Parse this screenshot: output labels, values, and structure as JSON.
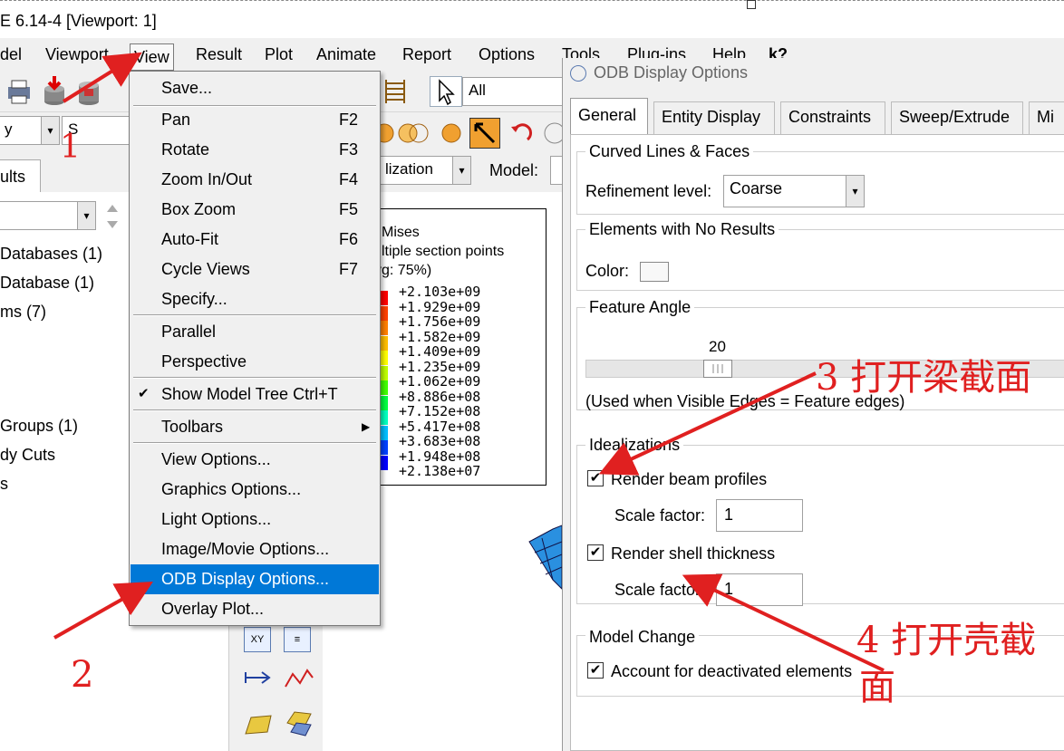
{
  "window": {
    "title": "E 6.14-4 [Viewport: 1]"
  },
  "menubar": {
    "items": [
      "del",
      "Viewport",
      "View",
      "Result",
      "Plot",
      "Animate",
      "Report",
      "Options",
      "Tools",
      "Plug-ins",
      "Help",
      "k?"
    ]
  },
  "toolbar": {
    "selection_combo": "All",
    "left_combo_1": "y",
    "left_combo_2": "S",
    "visualization_combo": "lization",
    "model_label": "Model:"
  },
  "left_panel": {
    "tab_label": "ults",
    "tree_items": [
      "Databases (1)",
      "Database (1)",
      "ms (7)",
      "Groups (1)",
      "dy Cuts",
      "s"
    ]
  },
  "legend": {
    "title_lines": [
      "Mises",
      "ltiple section points",
      "vg: 75%)"
    ],
    "values": [
      "+2.103e+09",
      "+1.929e+09",
      "+1.756e+09",
      "+1.582e+09",
      "+1.409e+09",
      "+1.235e+09",
      "+1.062e+09",
      "+8.886e+08",
      "+7.152e+08",
      "+5.417e+08",
      "+3.683e+08",
      "+1.948e+08",
      "+2.138e+07"
    ],
    "colors": [
      "#ff0000",
      "#ff4000",
      "#ff8000",
      "#ffbf00",
      "#ffff00",
      "#bfff00",
      "#40ff00",
      "#00ff40",
      "#00ffbf",
      "#00bfff",
      "#0040ff",
      "#0000ff"
    ]
  },
  "view_menu": {
    "items": [
      {
        "label": "Save...",
        "shortcut": ""
      },
      {
        "label": "Pan",
        "shortcut": "F2"
      },
      {
        "label": "Rotate",
        "shortcut": "F3"
      },
      {
        "label": "Zoom In/Out",
        "shortcut": "F4"
      },
      {
        "label": "Box Zoom",
        "shortcut": "F5"
      },
      {
        "label": "Auto-Fit",
        "shortcut": "F6"
      },
      {
        "label": "Cycle Views",
        "shortcut": "F7"
      },
      {
        "label": "Specify...",
        "shortcut": ""
      },
      {
        "label": "Parallel",
        "shortcut": ""
      },
      {
        "label": "Perspective",
        "shortcut": ""
      },
      {
        "label": "Show Model Tree Ctrl+T",
        "shortcut": ""
      },
      {
        "label": "Toolbars",
        "shortcut": ""
      },
      {
        "label": "View Options...",
        "shortcut": ""
      },
      {
        "label": "Graphics Options...",
        "shortcut": ""
      },
      {
        "label": "Light Options...",
        "shortcut": ""
      },
      {
        "label": "Image/Movie Options...",
        "shortcut": ""
      },
      {
        "label": "ODB Display Options...",
        "shortcut": ""
      },
      {
        "label": "Overlay Plot...",
        "shortcut": ""
      }
    ]
  },
  "dialog": {
    "title": "ODB Display Options",
    "tabs": [
      "General",
      "Entity Display",
      "Constraints",
      "Sweep/Extrude",
      "Mi"
    ],
    "curved": {
      "title": "Curved Lines & Faces",
      "refinement_label": "Refinement level:",
      "refinement_value": "Coarse"
    },
    "no_results": {
      "title": "Elements with No Results",
      "color_label": "Color:"
    },
    "feature_angle": {
      "title": "Feature Angle",
      "value": "20",
      "note": "(Used when Visible Edges = Feature edges)"
    },
    "idealizations": {
      "title": "Idealizations",
      "beam_label": "Render beam profiles",
      "beam_scale_label": "Scale factor:",
      "beam_scale_value": "1",
      "shell_label": "Render shell thickness",
      "shell_scale_label": "Scale factor:",
      "shell_scale_value": "1"
    },
    "model_change": {
      "title": "Model Change",
      "deactivated_label": "Account for deactivated elements"
    }
  },
  "annotations": {
    "n1": "1",
    "n2": "2",
    "n3": "3 打开梁截面",
    "n4a": "4 打开壳截",
    "n4b": "面",
    "color": "#e02020"
  }
}
